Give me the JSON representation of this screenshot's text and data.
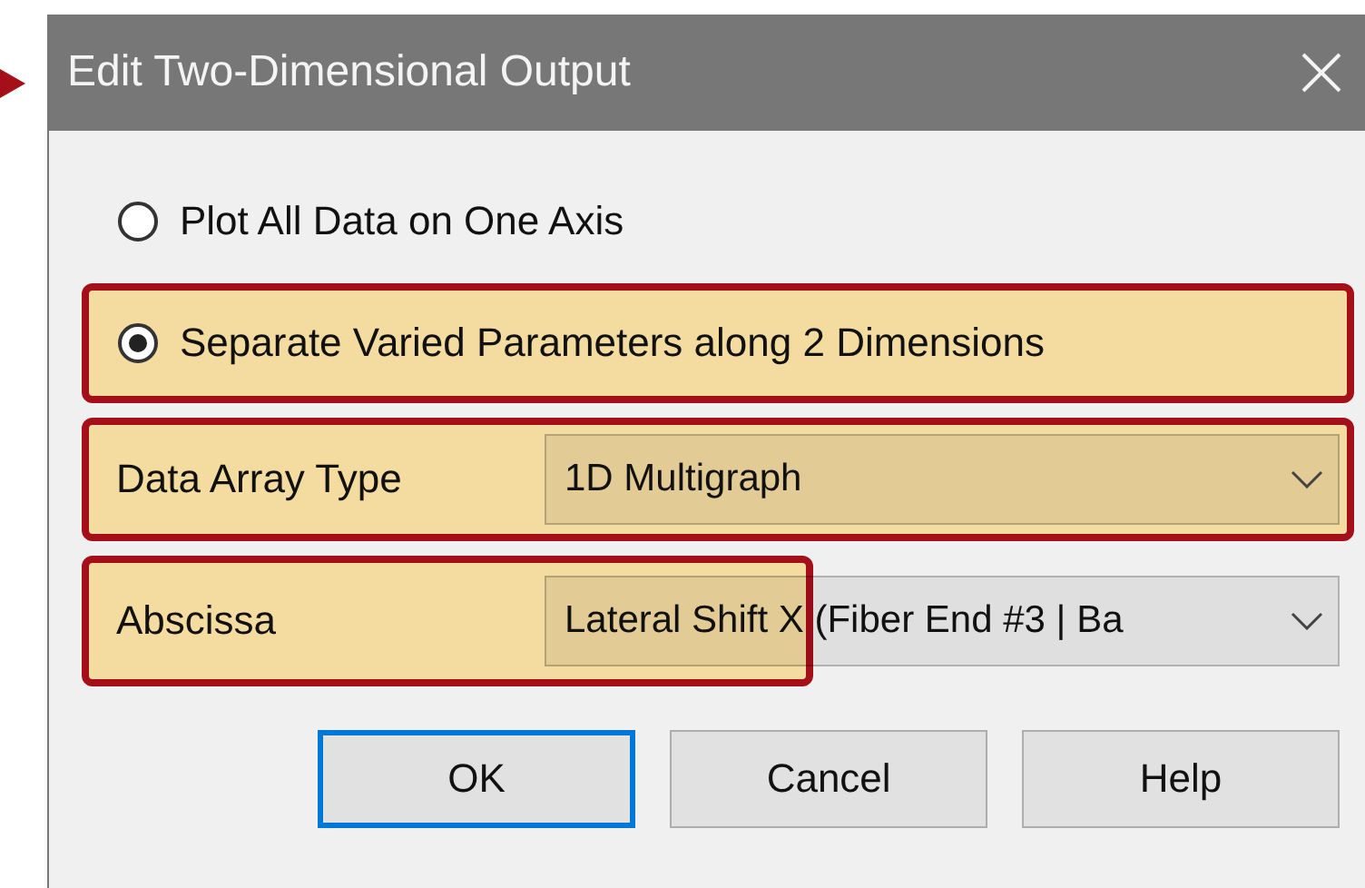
{
  "window": {
    "title": "Edit Two-Dimensional Output"
  },
  "options": [
    {
      "label": "Plot All Data on One Axis",
      "selected": false,
      "highlighted": false
    },
    {
      "label": "Separate Varied Parameters along 2 Dimensions",
      "selected": true,
      "highlighted": true
    }
  ],
  "fields": [
    {
      "label": "Data Array Type",
      "value": "1D Multigraph",
      "highlighted": true,
      "kind": "wide"
    },
    {
      "label": "Abscissa",
      "value": "Lateral Shift X (Fiber End #3 | Ba",
      "highlighted": true,
      "kind": "narrow"
    }
  ],
  "buttons": [
    {
      "label": "OK",
      "default": true
    },
    {
      "label": "Cancel",
      "default": false
    },
    {
      "label": "Help",
      "default": false
    }
  ]
}
